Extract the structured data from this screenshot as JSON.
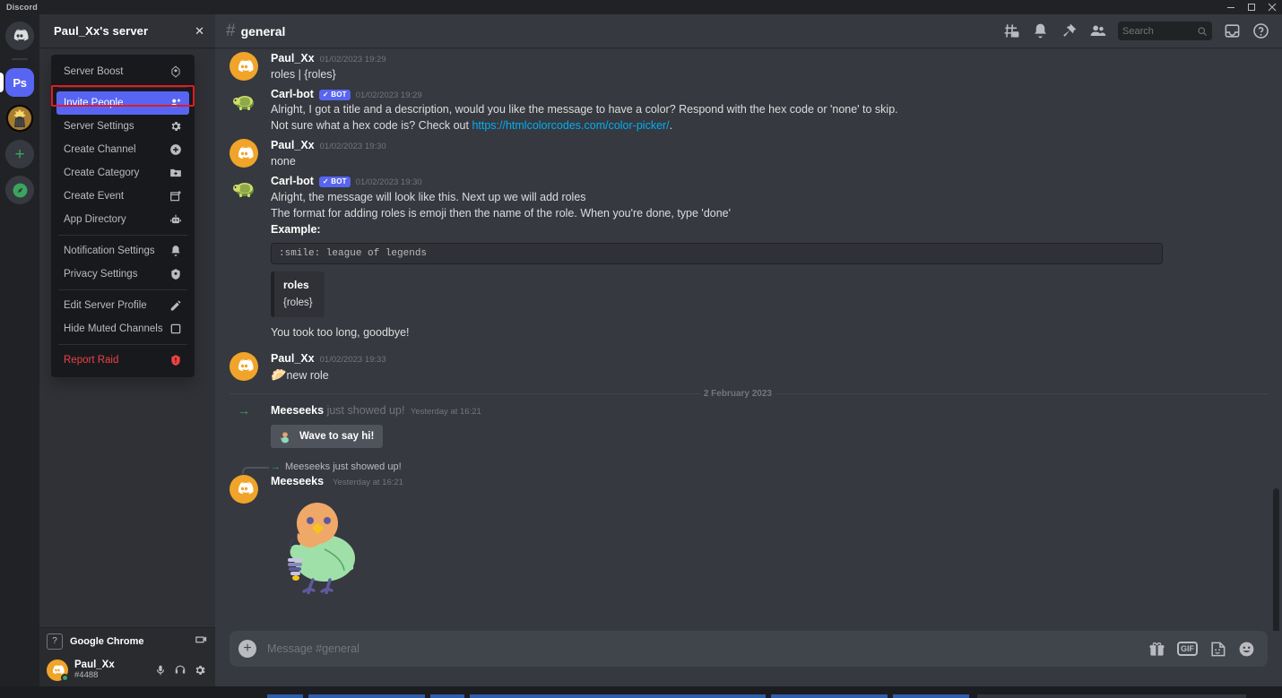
{
  "window": {
    "app_title": "Discord",
    "controls": {
      "minimize": "minimize-icon",
      "maximize": "maximize-icon",
      "close": "close-icon"
    }
  },
  "rail": {
    "items": [
      {
        "name": "home",
        "label": "Discord",
        "icon": "discord-logo-icon"
      },
      {
        "name": "server-ps",
        "label": "Ps",
        "icon": "server-avatar"
      },
      {
        "name": "server-dark",
        "label": "",
        "icon": "server-avatar"
      },
      {
        "name": "add-server",
        "label": "+",
        "icon": "plus-icon"
      },
      {
        "name": "explore",
        "label": "",
        "icon": "compass-icon"
      }
    ]
  },
  "sidebar": {
    "server_name": "Paul_Xx's server",
    "close_label": "✕"
  },
  "context_menu": {
    "items": [
      {
        "label": "Server Boost",
        "icon": "boost-icon",
        "selected": false,
        "danger": false
      },
      {
        "label": "Invite People",
        "icon": "person-add-icon",
        "selected": true,
        "danger": false
      },
      {
        "label": "Server Settings",
        "icon": "gear-icon",
        "selected": false,
        "danger": false
      },
      {
        "label": "Create Channel",
        "icon": "plus-circle-icon",
        "selected": false,
        "danger": false
      },
      {
        "label": "Create Category",
        "icon": "folder-plus-icon",
        "selected": false,
        "danger": false
      },
      {
        "label": "Create Event",
        "icon": "calendar-add-icon",
        "selected": false,
        "danger": false
      },
      {
        "label": "App Directory",
        "icon": "robot-icon",
        "selected": false,
        "danger": false
      },
      {
        "label": "Notification Settings",
        "icon": "bell-icon",
        "selected": false,
        "danger": false
      },
      {
        "label": "Privacy Settings",
        "icon": "shield-icon",
        "selected": false,
        "danger": false
      },
      {
        "label": "Edit Server Profile",
        "icon": "pencil-icon",
        "selected": false,
        "danger": false
      },
      {
        "label": "Hide Muted Channels",
        "icon": "checkbox-icon",
        "selected": false,
        "danger": false
      },
      {
        "label": "Report Raid",
        "icon": "shield-alert-icon",
        "selected": false,
        "danger": true
      }
    ],
    "highlight_color": "#e01b24",
    "selected_color": "#5865f2"
  },
  "now_playing": {
    "icon": "question-box-icon",
    "app": "Google Chrome",
    "share_icon": "screen-share-icon"
  },
  "user_panel": {
    "username": "Paul_Xx",
    "tag": "#4488",
    "status": "online",
    "status_color": "#3ba55d",
    "icons": [
      "microphone-icon",
      "headphones-icon",
      "gear-icon"
    ]
  },
  "channel_header": {
    "hash": "#",
    "name": "general",
    "right_icons": [
      "threads-icon",
      "bell-icon",
      "pin-icon",
      "members-icon",
      "inbox-icon",
      "help-icon"
    ]
  },
  "search": {
    "placeholder": "Search",
    "icon": "search-icon"
  },
  "messages": [
    {
      "type": "message",
      "avatar": "discord",
      "author": "Paul_Xx",
      "bot": false,
      "timestamp": "01/02/2023 19:29",
      "lines": [
        "roles | {roles}"
      ]
    },
    {
      "type": "message",
      "avatar": "turtle",
      "author": "Carl-bot",
      "bot": true,
      "bot_label": "BOT",
      "timestamp": "01/02/2023 19:29",
      "lines": [
        "Alright, I got a title and a description, would you like the message to have a color? Respond with the hex code or 'none' to skip.",
        "Not sure what a hex code is? Check out "
      ],
      "link": "https://htmlcolorcodes.com/color-picker/",
      "link_suffix": "."
    },
    {
      "type": "message",
      "avatar": "discord",
      "author": "Paul_Xx",
      "bot": false,
      "timestamp": "01/02/2023 19:30",
      "lines": [
        "none"
      ]
    },
    {
      "type": "message",
      "avatar": "turtle",
      "author": "Carl-bot",
      "bot": true,
      "bot_label": "BOT",
      "timestamp": "01/02/2023 19:30",
      "lines": [
        "Alright, the message will look like this. Next up we will add roles",
        "The format for adding roles is emoji then the name of the role. When you're done, type 'done'"
      ],
      "bold_line": "Example:",
      "code": ":smile: league of legends",
      "embed": {
        "title": "roles",
        "description": "{roles}"
      },
      "trailing": "You took too long, goodbye!"
    },
    {
      "type": "message",
      "avatar": "discord",
      "author": "Paul_Xx",
      "bot": false,
      "timestamp": "01/02/2023 19:33",
      "emoji": "🥟",
      "lines": [
        "new role"
      ]
    }
  ],
  "date_divider": "2 February 2023",
  "join_message": {
    "user": "Meeseeks",
    "text": "just showed up!",
    "timestamp": "Yesterday at 16:21",
    "button_label": "Wave to say hi!",
    "button_icon": "wave-emoji"
  },
  "reply_message": {
    "reference_arrow": "→",
    "reference_text": "Meeseeks just showed up!",
    "author": "Meeseeks",
    "timestamp": "Yesterday at 16:21",
    "sticker": "bird-sticker"
  },
  "composer": {
    "placeholder": "Message #general",
    "plus_icon": "plus-icon",
    "icons": [
      "gift-icon",
      "gif-icon",
      "sticker-icon",
      "emoji-icon"
    ],
    "gif_label": "GIF"
  }
}
